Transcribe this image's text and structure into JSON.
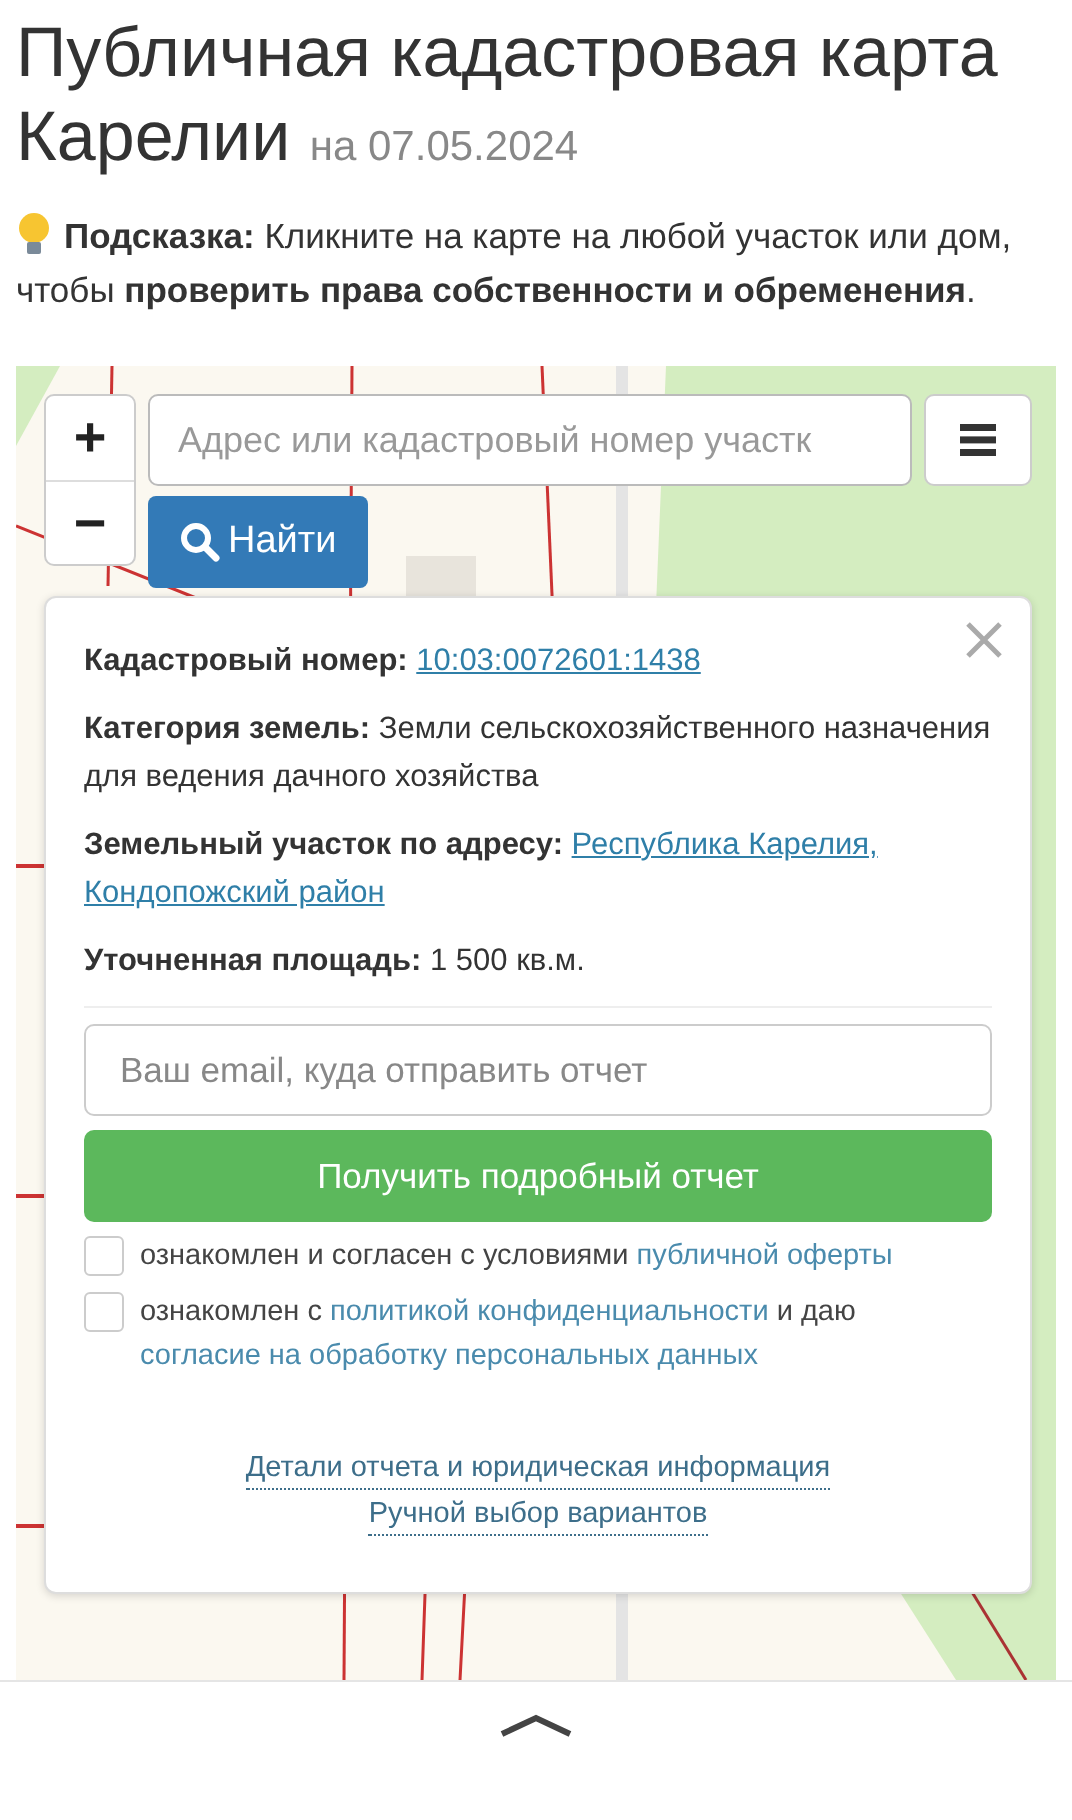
{
  "title": {
    "text": "Публичная кадастровая карта Карелии",
    "date": "на 07.05.2024"
  },
  "hint": "**Подсказка:** Кликните на карте на любой участок или дом, чтобы **проверить права собственности и обременения**.",
  "map": {
    "kind": "picture",
    "zoom_in": "+",
    "zoom_out": "−",
    "search": {
      "placeholder": "Адрес или кадастровый номер участк"
    },
    "search_button": "Найти"
  },
  "popup": {
    "fields": [
      {
        "label": "Кадастровый номер:",
        "kind": "link",
        "values": [
          "10:03:0072601:1438"
        ]
      },
      {
        "label": "Категория земель:",
        "kind": "text",
        "values": [
          "Земли сельскохозяйственного назначения",
          "для ведения дачного хозяйства"
        ]
      },
      {
        "label": "Земельный участок по адресу:",
        "kind": "link",
        "values": [
          "Республика Карелия,",
          "Кондопожский район"
        ]
      },
      {
        "label": "Уточненная площадь:",
        "kind": "text",
        "values": [
          "1 500 кв.м."
        ]
      }
    ],
    "email": {
      "placeholder": "Ваш email, куда отправить отчет"
    },
    "submit": "Получить подробный отчет",
    "consents": [
      {
        "checked": false,
        "parts": [
          {
            "kind": "text",
            "text": "ознакомлен и согласен с условиями "
          },
          {
            "kind": "link",
            "text": "публичной оферты"
          }
        ]
      },
      {
        "checked": false,
        "parts": [
          {
            "kind": "text",
            "text": "ознакомлен с "
          },
          {
            "kind": "link",
            "text": "политикой конфиденциальности"
          },
          {
            "kind": "text",
            "text": " и даю "
          },
          {
            "kind": "link",
            "text": "согласие на обработку персональных данных"
          }
        ]
      }
    ],
    "links": [
      "Детали отчета и юридическая информация",
      "Ручной выбор вариантов"
    ]
  }
}
